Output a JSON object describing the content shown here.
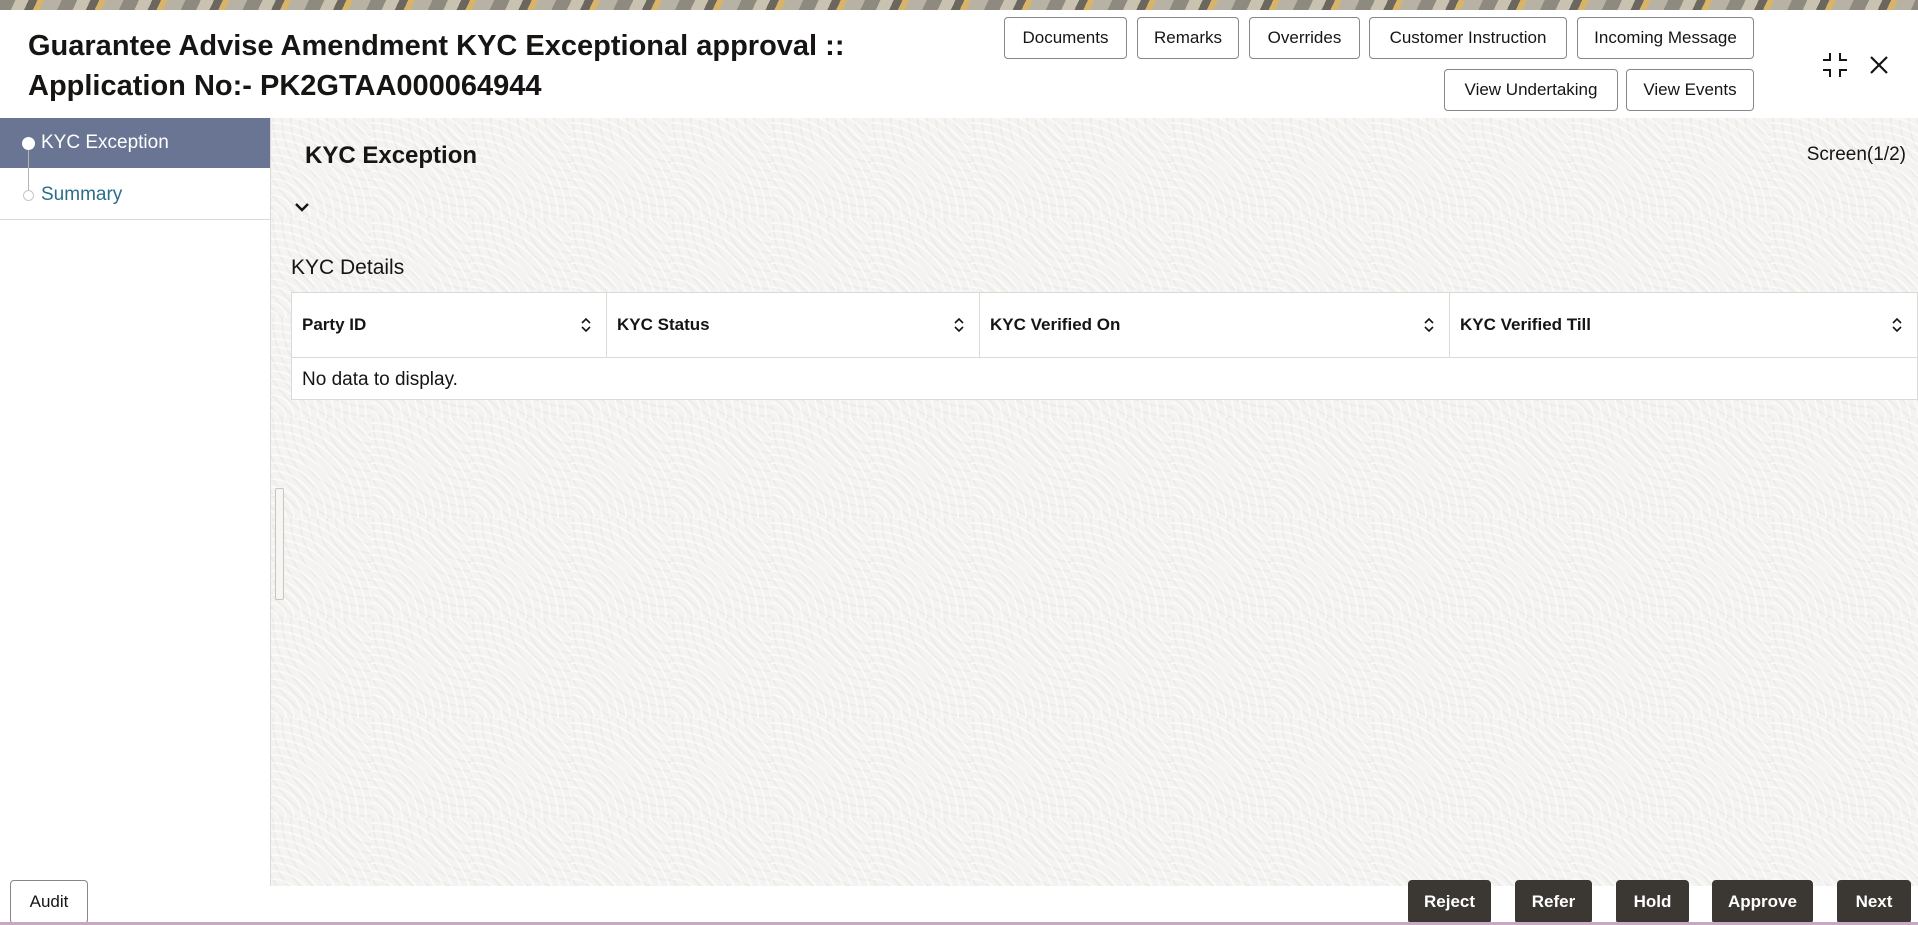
{
  "window": {
    "title_line1": "Guarantee Advise Amendment KYC Exceptional approval ::",
    "title_line2": "Application No:- PK2GTAA000064944"
  },
  "header_buttons": {
    "documents": "Documents",
    "remarks": "Remarks",
    "overrides": "Overrides",
    "customer_instruction": "Customer Instruction",
    "incoming_message": "Incoming Message",
    "view_undertaking": "View Undertaking",
    "view_events": "View Events"
  },
  "header_icons": {
    "collapse": "collapse-icon",
    "close": "close-icon"
  },
  "sidebar": {
    "items": [
      {
        "label": "KYC Exception",
        "active": true
      },
      {
        "label": "Summary",
        "active": false
      }
    ]
  },
  "main": {
    "section_title": "KYC Exception",
    "screen_counter": "Screen(1/2)",
    "kyc_details_label": "KYC Details",
    "table": {
      "columns": [
        "Party ID",
        "KYC Status",
        "KYC Verified On",
        "KYC Verified Till"
      ],
      "empty_message": "No data to display."
    }
  },
  "footer": {
    "audit": "Audit",
    "reject": "Reject",
    "refer": "Refer",
    "hold": "Hold",
    "approve": "Approve",
    "next": "Next"
  },
  "colors": {
    "sidebar_active_bg": "#6a7593",
    "link_color": "#2b6d8c",
    "footer_button_bg": "#3b3834"
  }
}
